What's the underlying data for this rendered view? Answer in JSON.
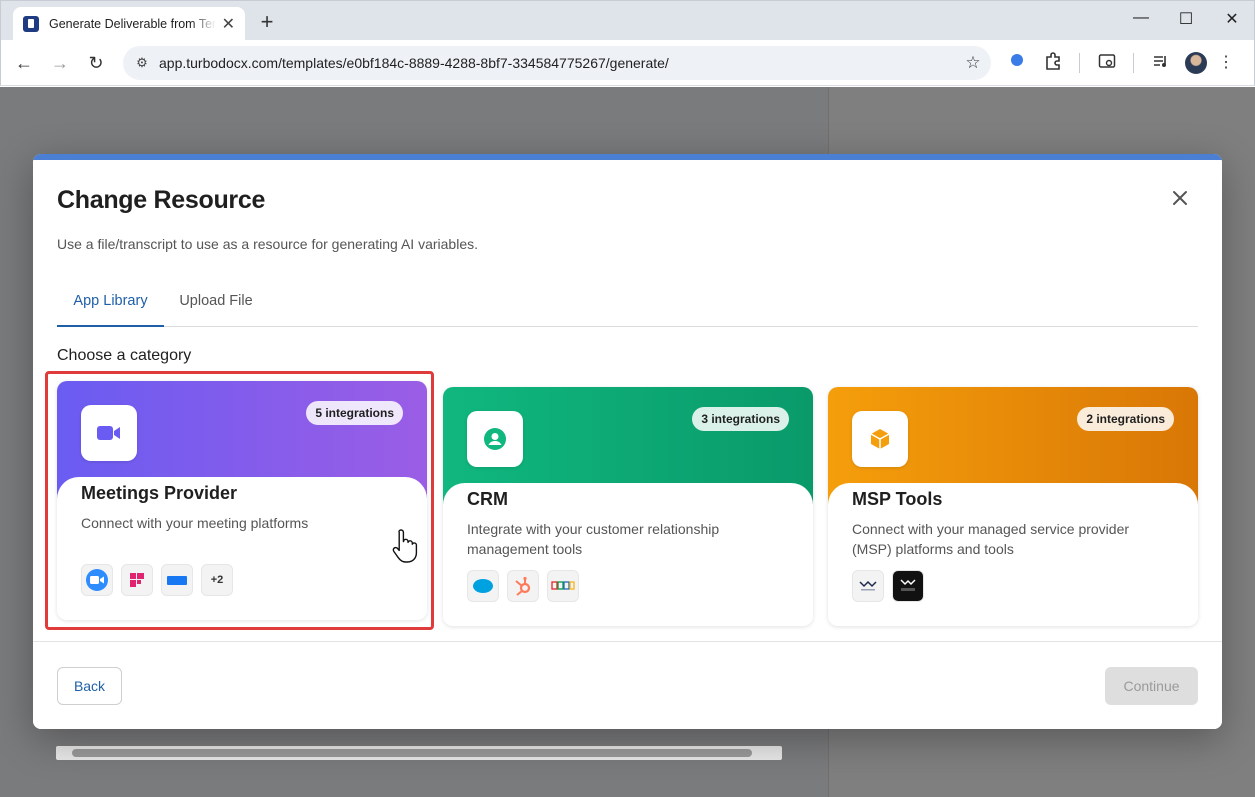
{
  "browser": {
    "tab_title": "Generate Deliverable from Template",
    "tab_close": "✕",
    "new_tab": "+",
    "url": "app.turbodocx.com/templates/e0bf184c-8889-4288-8bf7-334584775267/generate/",
    "window_controls": {
      "minimize": "—",
      "maximize": "☐",
      "close": "✕"
    }
  },
  "modal": {
    "title": "Change Resource",
    "subtitle": "Use a file/transcript to use as a resource for generating AI variables.",
    "tabs": [
      {
        "label": "App Library",
        "active": true
      },
      {
        "label": "Upload File",
        "active": false
      }
    ],
    "section_label": "Choose a category",
    "categories": [
      {
        "title": "Meetings Provider",
        "badge": "5 integrations",
        "description": "Connect with your meeting platforms",
        "icon": "video-camera-icon",
        "gradient": [
          "#6a5cf2",
          "#9b5de5"
        ],
        "logos": [
          "zoom-logo",
          "fireflies-logo",
          "teams-logo"
        ],
        "more": "+2",
        "selected": true
      },
      {
        "title": "CRM",
        "badge": "3 integrations",
        "description": "Integrate with your customer relationship management tools",
        "icon": "user-circle-icon",
        "gradient": [
          "#10b77f",
          "#0a9a6a"
        ],
        "logos": [
          "salesforce-logo",
          "hubspot-logo",
          "zoho-logo"
        ],
        "selected": false
      },
      {
        "title": "MSP Tools",
        "badge": "2 integrations",
        "description": "Connect with your managed service provider (MSP) platforms and tools",
        "icon": "box-icon",
        "gradient": [
          "#f59e0b",
          "#d97706"
        ],
        "logos": [
          "connectwise-logo",
          "halo-logo"
        ],
        "selected": false
      }
    ],
    "buttons": {
      "back": "Back",
      "continue": "Continue"
    }
  }
}
